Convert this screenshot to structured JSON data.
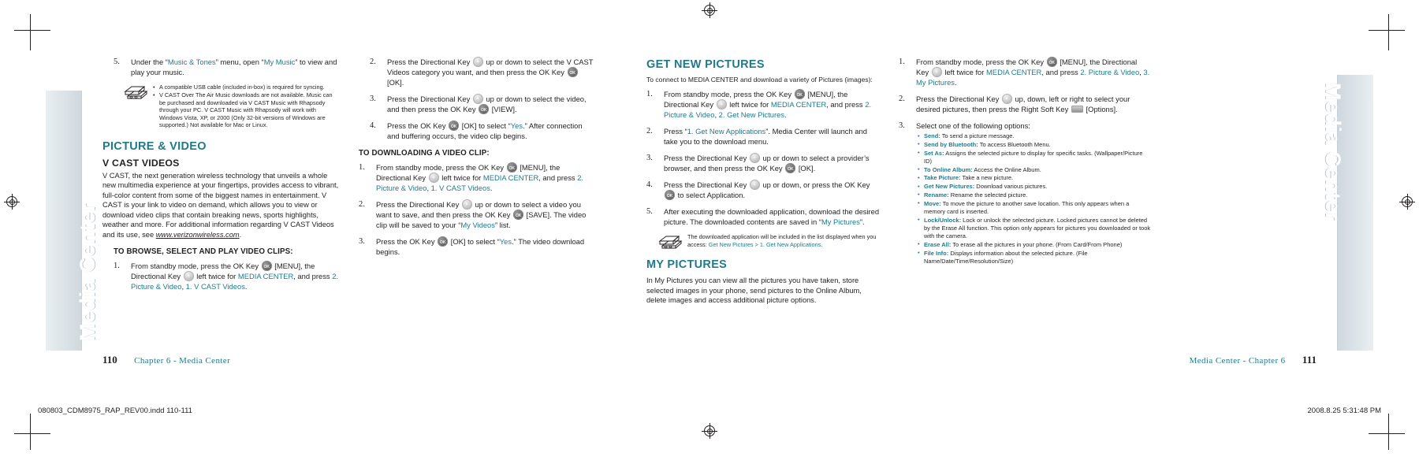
{
  "document": {
    "tab_label_left": "Media Center",
    "tab_label_right": "Media Center"
  },
  "left_page": {
    "folio_number": "110",
    "folio_text": "Chapter 6 - Media Center",
    "column1": {
      "step5": {
        "num": "5.",
        "text_a": "Under the “",
        "link_a": "Music & Tones",
        "text_b": "” menu, open “",
        "link_b": "My Music",
        "text_c": "” to view and play your music."
      },
      "note_bullets": [
        "A compatible USB cable (included in-box) is required for syncing.",
        "V CAST Over The Air Music downloads are not available. Music can be purchased and downloaded via V CAST Music with Rhapsody through your PC. V CAST Music with Rhapsody will work with Windows Vista, XP, or 2000 (Only 32-bit versions of Windows are supported.) Not available for Mac or Linux."
      ],
      "section_title": "PICTURE & VIDEO",
      "sub_title": "V CAST VIDEOS",
      "body_a": "V CAST, the next generation wireless technology that unveils a whole new multimedia experience at your fingertips, provides access to vibrant, full-color content from some of the biggest names in entertainment. V CAST is your link to video on demand, which allows you to view or download video clips that contain breaking news, sports highlights, weather and more. For additional information regarding V CAST Videos and its use, see ",
      "body_url": "www.verizonwireless.com",
      "body_b": ".",
      "proc_title": "TO BROWSE, SELECT AND PLAY VIDEO CLIPS:",
      "step1": {
        "num": "1.",
        "p1": "From standby mode, press the OK Key ",
        "p2": " [MENU], the Directional Key ",
        "p3": " left twice for ",
        "link1": "MEDIA CENTER",
        "p4": ", and press ",
        "link2": "2. Picture & Video",
        "p5": ", ",
        "link3": "1. V CAST Videos",
        "p6": "."
      }
    },
    "column2": {
      "step2": {
        "num": "2.",
        "p1": "Press the Directional Key ",
        "p2": " up or down to select the V CAST Videos category you want, and then press the OK Key ",
        "p3": " [OK]."
      },
      "step3": {
        "num": "3.",
        "p1": "Press the Directional Key ",
        "p2": " up or down to select the video, and then press the OK Key ",
        "p3": " [VIEW]."
      },
      "step4": {
        "num": "4.",
        "p1": "Press the OK Key ",
        "p2": " [OK] to select “",
        "link1": "Yes",
        "p3": ".” After connection and buffering occurs, the video clip begins."
      },
      "proc_title": "TO DOWNLOADING A VIDEO CLIP:",
      "dl_step1": {
        "num": "1.",
        "p1": "From standby mode, press the OK Key ",
        "p2": " [MENU], the Directional Key ",
        "p3": " left twice for ",
        "link1": "MEDIA CENTER",
        "p4": ", and press ",
        "link2": "2. Picture & Video",
        "p5": ", ",
        "link3": "1. V CAST Videos",
        "p6": "."
      },
      "dl_step2": {
        "num": "2.",
        "p1": "Press the Directional Key ",
        "p2": " up or down to select a video you want to save, and then press the OK Key ",
        "p3": " [SAVE]. The video clip will be saved to your “",
        "link1": "My Videos",
        "p4": "” list."
      },
      "dl_step3": {
        "num": "3.",
        "p1": "Press the OK Key ",
        "p2": " [OK] to select “",
        "link1": "Yes",
        "p3": ".” The video download begins."
      }
    }
  },
  "right_page": {
    "folio_number": "111",
    "folio_text": "Media Center - Chapter 6",
    "column3": {
      "section_title": "GET NEW PICTURES",
      "lead": "To connect to MEDIA CENTER and download a variety of Pictures (images):",
      "step1": {
        "num": "1.",
        "p1": "From standby mode, press the OK Key ",
        "p2": " [MENU], the Directional Key ",
        "p3": " left twice for ",
        "link1": "MEDIA CENTER",
        "p4": ", and press ",
        "link2": "2. Picture & Video",
        "p5": ", ",
        "link3": "2. Get New Pictures",
        "p6": "."
      },
      "step2": {
        "num": "2.",
        "p1": "Press “",
        "link1": "1. Get New Applications",
        "p2": "”. Media Center will launch and take you to the download menu."
      },
      "step3": {
        "num": "3.",
        "p1": "Press the Directional Key ",
        "p2": " up or down to select a provider’s browser, and then press the OK Key ",
        "p3": " [OK]."
      },
      "step4": {
        "num": "4.",
        "p1": "Press the Directional Key ",
        "p2": " up or down, or press the OK Key ",
        "p3": " to select Application."
      },
      "step5": {
        "num": "5.",
        "p1": "After executing the downloaded application, download the desired picture. The downloaded contents are saved in “",
        "link1": "My Pictures",
        "p2": "”."
      },
      "note": {
        "p1": "The downloaded application will be included in the list displayed when you access: ",
        "link1": "Get New Pictures > 1. Get New Applications",
        "p2": "."
      },
      "my_pictures_title": "MY PICTURES",
      "my_pictures_body": "In My Pictures you can view all the pictures you have taken, store selected images in your phone, send pictures to the Online Album, delete images and access additional picture options."
    },
    "column4": {
      "step1": {
        "num": "1.",
        "p1": "From standby mode, press the OK Key ",
        "p2": " [MENU], the Directional Key ",
        "p3": " left twice for ",
        "link1": "MEDIA CENTER",
        "p4": ", and press ",
        "link2": "2. Picture & Video",
        "p5": ", ",
        "link3": "3. My Pictures",
        "p6": "."
      },
      "step2": {
        "num": "2.",
        "p1": "Press the Directional Key ",
        "p2": " up, down, left or right to select your desired pictures, then press the Right Soft Key ",
        "p3": " [Options]."
      },
      "step3": {
        "num": "3.",
        "p1": "Select one of the following options:"
      },
      "options": [
        {
          "label": "Send:",
          "desc": " To send a picture message."
        },
        {
          "label": "Send by Bluetooth:",
          "desc": " To access Bluetooth Menu."
        },
        {
          "label": "Set As:",
          "desc": " Assigns the selected picture to display for specific tasks. (Wallpaper/Picture ID)"
        },
        {
          "label": "To Online Album:",
          "desc": " Access the Online Album."
        },
        {
          "label": "Take Picture:",
          "desc": " Take a new picture."
        },
        {
          "label": "Get New Pictures:",
          "desc": " Download various pictures."
        },
        {
          "label": "Rename:",
          "desc": " Rename the selected picture."
        },
        {
          "label": "Move:",
          "desc": " To move the picture to another save location. This only appears when a memory card is inserted."
        },
        {
          "label": "Lock/Unlock:",
          "desc": " Lock or unlock the selected picture. Locked pictures cannot be deleted by the Erase All function. This option only appears for pictures you downloaded or took with the camera."
        },
        {
          "label": "Erase All:",
          "desc": " To erase all the pictures in your phone. (From Card/From Phone)"
        },
        {
          "label": "File Info:",
          "desc": " Displays information about the selected picture. (File Name/Date/Time/Resolution/Size)"
        }
      ]
    }
  },
  "footer": {
    "left": "080803_CDM8975_RAP_REV00.indd   110-111",
    "right": "2008.8.25   5:31:48 PM"
  },
  "colors": {
    "teal": "#1f7a8c",
    "text": "#231f20"
  }
}
